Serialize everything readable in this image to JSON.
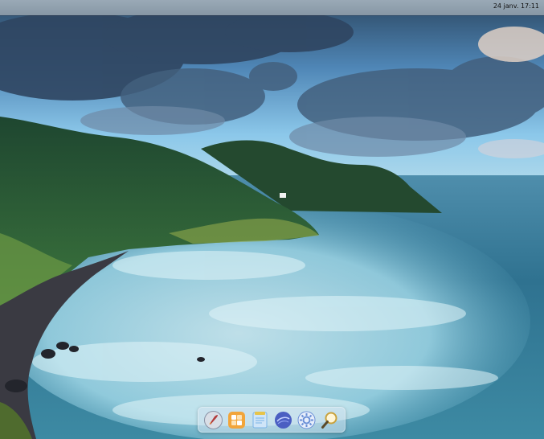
{
  "desktop": {
    "wallpaper_description": "",
    "colors": {
      "sky_top": "#2c4a63",
      "sky_light": "#7fc3e6",
      "sea": "#2b6b88",
      "foam": "#bfe8f2",
      "forest": "#1f4a2e"
    }
  },
  "topbar": {
    "clock_text": "24 janv. 17:11"
  },
  "dock": {
    "items": [
      {
        "name": "rocket-launcher-icon",
        "color": "#8a93a6"
      },
      {
        "name": "apps-grid-icon",
        "color": "#f2a53a"
      },
      {
        "name": "notes-icon",
        "color": "#7ab3e6"
      },
      {
        "name": "web-browser-icon",
        "color": "#4b5fc2"
      },
      {
        "name": "settings-gear-icon",
        "color": "#6a8fd6"
      },
      {
        "name": "search-magnifier-icon",
        "color": "#c9a23c"
      }
    ]
  }
}
